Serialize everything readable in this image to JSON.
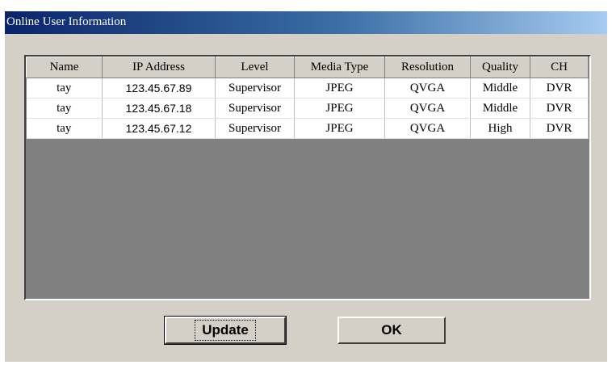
{
  "window": {
    "title": "Online User Information"
  },
  "table": {
    "columns": [
      "Name",
      "IP Address",
      "Level",
      "Media Type",
      "Resolution",
      "Quality",
      "CH"
    ],
    "rows": [
      [
        "tay",
        "123.45.67.89",
        "Supervisor",
        "JPEG",
        "QVGA",
        "Middle",
        "DVR"
      ],
      [
        "tay",
        "123.45.67.18",
        "Supervisor",
        "JPEG",
        "QVGA",
        "Middle",
        "DVR"
      ],
      [
        "tay",
        "123.45.67.12",
        "Supervisor",
        "JPEG",
        "QVGA",
        "High",
        "DVR"
      ]
    ]
  },
  "buttons": {
    "update_label": "Update",
    "ok_label": "OK"
  },
  "colors": {
    "dialog_face": "#d4d0c8",
    "titlebar_start": "#0a246a",
    "titlebar_end": "#a6caf0",
    "list_empty_area": "#808080"
  }
}
